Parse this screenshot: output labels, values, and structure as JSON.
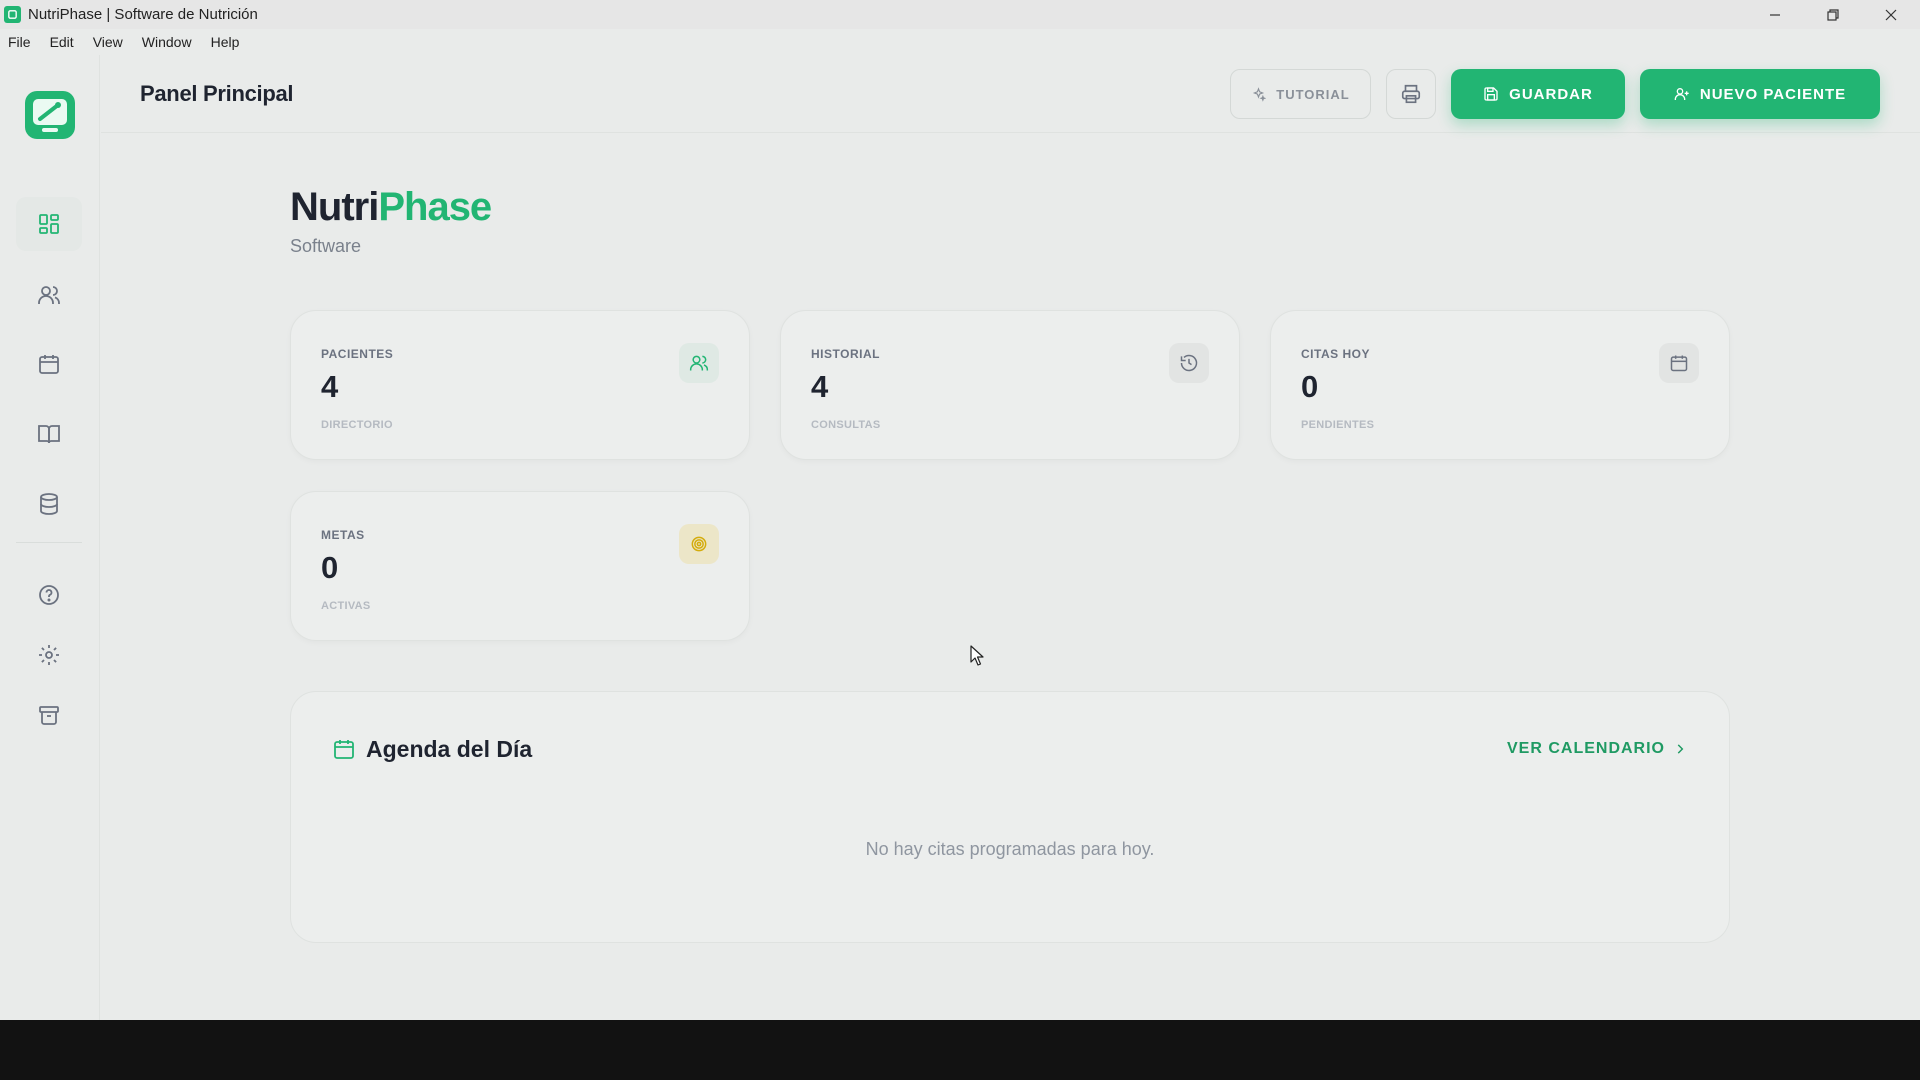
{
  "window": {
    "title": "NutriPhase | Software de Nutrición"
  },
  "menu": {
    "items": [
      "File",
      "Edit",
      "View",
      "Window",
      "Help"
    ]
  },
  "header": {
    "title": "Panel Principal",
    "tutorial_label": "TUTORIAL",
    "save_label": "GUARDAR",
    "new_patient_label": "NUEVO PACIENTE"
  },
  "brand": {
    "name_part1": "Nutri",
    "name_part2": "Phase",
    "subtitle": "Software"
  },
  "stats": [
    {
      "label": "PACIENTES",
      "value": "4",
      "sub": "DIRECTORIO",
      "icon": "users-icon"
    },
    {
      "label": "HISTORIAL",
      "value": "4",
      "sub": "CONSULTAS",
      "icon": "history-icon"
    },
    {
      "label": "CITAS HOY",
      "value": "0",
      "sub": "PENDIENTES",
      "icon": "calendar-icon"
    },
    {
      "label": "METAS",
      "value": "0",
      "sub": "ACTIVAS",
      "icon": "target-icon"
    }
  ],
  "agenda": {
    "title": "Agenda del Día",
    "link_label": "VER CALENDARIO",
    "empty_text": "No hay citas programadas para hoy."
  },
  "colors": {
    "accent": "#22b573",
    "accent_dark": "#1f9a63",
    "goal_yellow": "#d4ac0d"
  }
}
